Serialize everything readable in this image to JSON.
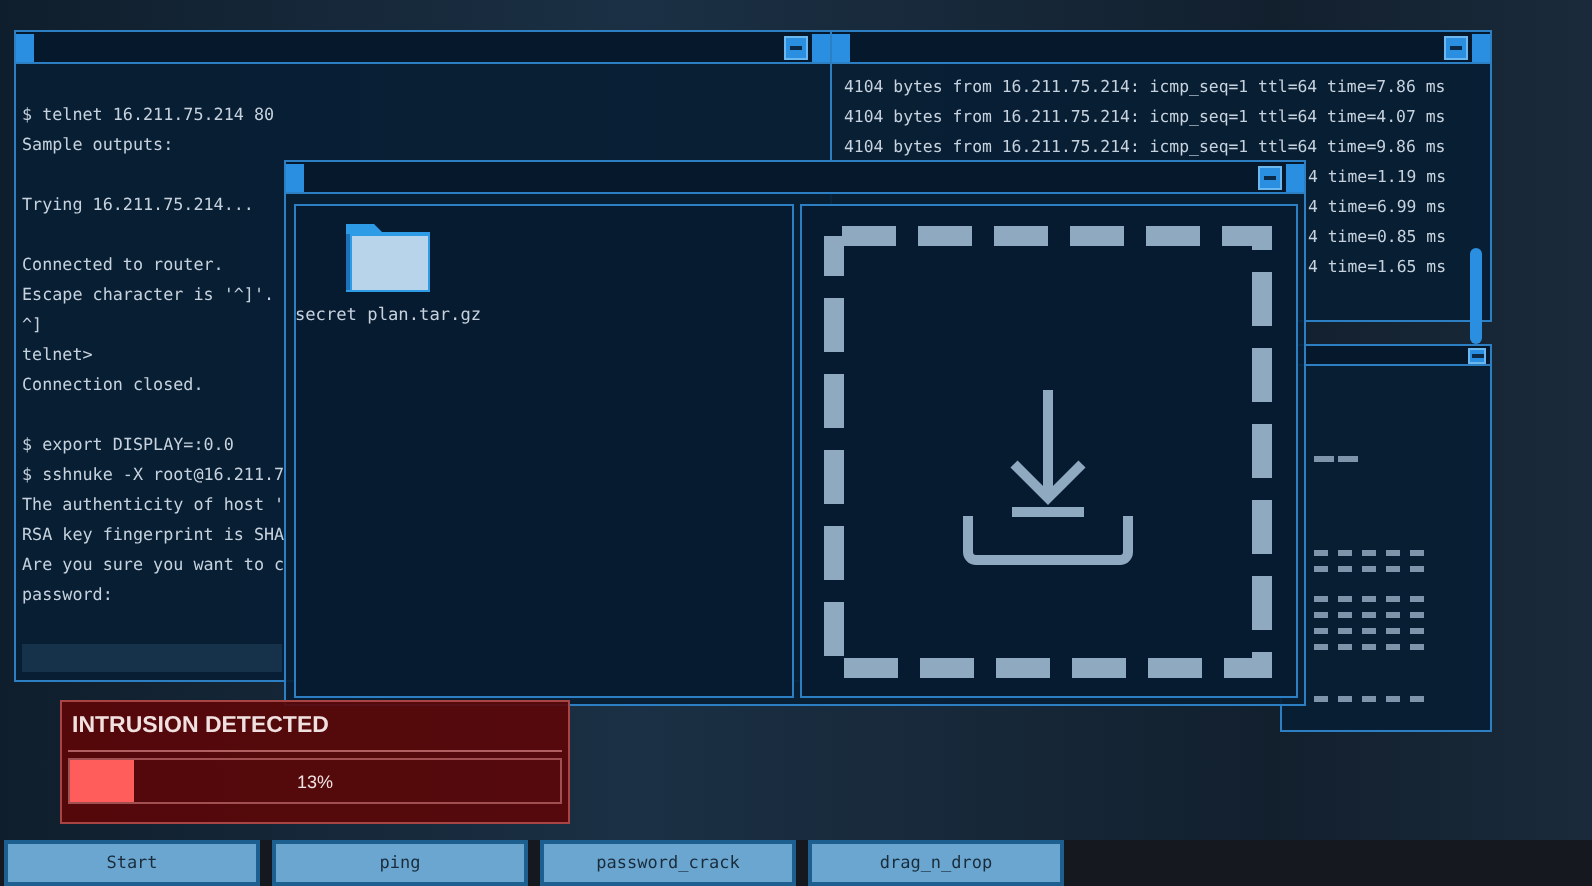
{
  "terminal": {
    "blocks": [
      [
        "$ telnet 16.211.75.214 80",
        "Sample outputs:"
      ],
      [
        "Trying 16.211.75.214..."
      ],
      [
        "Connected to router.",
        "Escape character is '^]'.",
        "^]",
        "telnet>",
        "Connection closed."
      ],
      [
        "$ export DISPLAY=:0.0",
        "$ sshnuke -X root@16.211.7",
        "The authenticity of host '",
        "RSA key fingerprint is SHA",
        "Are you sure you want to c",
        "password:"
      ]
    ]
  },
  "ping": {
    "lines": [
      {
        "text": "4104 bytes from 16.211.75.214: icmp_seq=1 ttl=64 time=7.86 ms",
        "cut": false
      },
      {
        "text": "4104 bytes from 16.211.75.214: icmp_seq=1 ttl=64 time=4.07 ms",
        "cut": false
      },
      {
        "text": "4104 bytes from 16.211.75.214: icmp_seq=1 ttl=64 time=9.86 ms",
        "cut": false
      },
      {
        "text": "4 time=1.19 ms",
        "cut": true
      },
      {
        "text": "4 time=6.99 ms",
        "cut": true
      },
      {
        "text": "4 time=0.85 ms",
        "cut": true
      },
      {
        "text": "4 time=1.65 ms",
        "cut": true
      }
    ]
  },
  "file_drop": {
    "files": [
      {
        "name": "secret plan.tar.gz"
      }
    ]
  },
  "alert": {
    "title": "INTRUSION DETECTED",
    "level": 0.13,
    "reading": "13%"
  },
  "taskbar": {
    "buttons": [
      "Start",
      "ping",
      "password_crack",
      "drag_n_drop"
    ]
  }
}
